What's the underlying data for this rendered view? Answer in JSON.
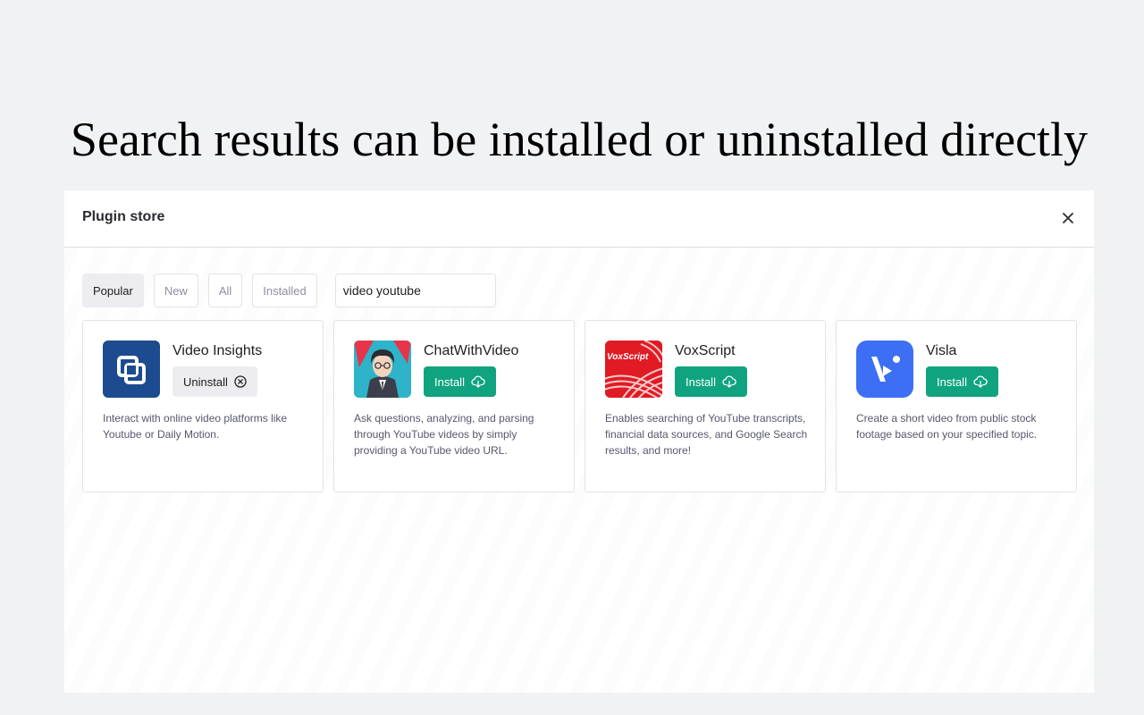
{
  "caption": "Search results can be installed or uninstalled directly",
  "modal": {
    "title": "Plugin store"
  },
  "filters": {
    "tabs": [
      {
        "label": "Popular",
        "active": true
      },
      {
        "label": "New",
        "active": false
      },
      {
        "label": "All",
        "active": false
      },
      {
        "label": "Installed",
        "active": false
      }
    ],
    "search_value": "video youtube"
  },
  "plugins": [
    {
      "name": "Video Insights",
      "action": "Uninstall",
      "action_icon": "circle-x-icon",
      "description": "Interact with online video platforms like Youtube or Daily Motion.",
      "logo": "video-insights-logo",
      "logo_color": "#1c4b8f"
    },
    {
      "name": "ChatWithVideo",
      "action": "Install",
      "action_icon": "cloud-download-icon",
      "description": "Ask questions, analyzing, and parsing through YouTube videos by simply providing a YouTube video URL.",
      "logo": "chatwithvideo-logo",
      "logo_color": "#2fb3c9"
    },
    {
      "name": "VoxScript",
      "action": "Install",
      "action_icon": "cloud-download-icon",
      "description": "Enables searching of YouTube transcripts, financial data sources, and Google Search results, and more!",
      "logo": "voxscript-logo",
      "logo_text": "VoxScript",
      "logo_color": "#e01b24"
    },
    {
      "name": "Visla",
      "action": "Install",
      "action_icon": "cloud-download-icon",
      "description": "Create a short video from public stock footage based on your specified topic.",
      "logo": "visla-logo",
      "logo_color": "#3d6ff5"
    }
  ],
  "colors": {
    "install": "#10a37f",
    "uninstall": "#ececf1",
    "background": "#f1f2f4"
  }
}
